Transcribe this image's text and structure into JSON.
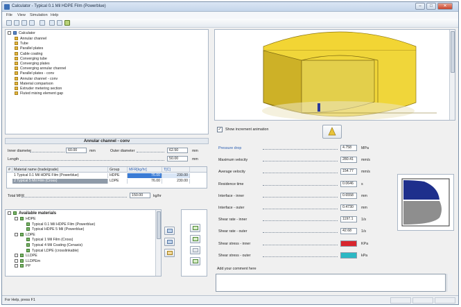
{
  "window": {
    "title": "Calculator - Typical 0.1 Mil HDPE Film (Powerblue)",
    "minimize": "–",
    "maximize": "□",
    "close": "✕"
  },
  "menu": [
    "File",
    "View",
    "Simulation",
    "Help"
  ],
  "toolbar_icons": [
    "new-icon",
    "open-icon",
    "save-icon",
    "save-as-icon",
    "print-icon",
    "export-icon",
    "report-icon",
    "calculate-icon"
  ],
  "tree": {
    "root": "Calculator",
    "items": [
      "Annular channel",
      "Tube",
      "Parallel plates",
      "Cable coating",
      "Converging tube",
      "Converging plates",
      "Converging annular channel",
      "Parallel plates - conv",
      "Annular channel - conv",
      "Material comparison",
      "Extruder metering section",
      "Fluted mixing element gap"
    ]
  },
  "form": {
    "section_title": "Annular channel - conv",
    "inner_diameter_label": "Inner diameter",
    "inner_diameter_value": "60.00",
    "inner_diameter_unit": "mm",
    "outer_diameter_label": "Outer diameter",
    "outer_diameter_value": "62.50",
    "outer_diameter_unit": "mm",
    "length_label": "Length",
    "length_value": "50.00",
    "length_unit": "mm"
  },
  "materials_table": {
    "headers": [
      "#",
      "Material name (trade/grade)",
      "Group",
      "MFR[kg/hr]",
      "T[C]"
    ],
    "rows": [
      {
        "num": "1",
        "name": "Typical 0.1 Mil HDPE Film (Powerblue)",
        "group": "HDPE",
        "mfr": "76.00",
        "temp": "230.00"
      },
      {
        "num": "2",
        "name": "Typical 5 Mil Film (Cross)",
        "group": "LDPE",
        "mfr": "76.00",
        "temp": "230.00"
      }
    ]
  },
  "total_mfr": {
    "label": "Total MFR",
    "value": "150.00",
    "unit": "kg/hr"
  },
  "available_materials": {
    "title": "Available materials",
    "groups": [
      {
        "name": "HDPE",
        "items": [
          "Typical 0.1 Mil HDPE Film (Powerblue)",
          "Typical HDPE 5 Mil (Powerblue)"
        ]
      },
      {
        "name": "LDPE",
        "items": [
          "Typical 1 Mil Film (Cross)",
          "Typical 4 Mil Coating (Cenaxis)",
          "Typical LDPE (crosslinkable)"
        ]
      },
      {
        "name": "LLDPE",
        "items": []
      },
      {
        "name": "LLDPEm",
        "items": []
      },
      {
        "name": "PP",
        "items": []
      }
    ]
  },
  "show_animation_label": "Show increment animation",
  "results": [
    {
      "label": "Pressure drop",
      "value": "4.758",
      "unit": "MPa",
      "highlight": true
    },
    {
      "label": "Maximum velocity",
      "value": "280.41",
      "unit": "mm/s"
    },
    {
      "label": "Average velocity",
      "value": "154.77",
      "unit": "mm/s"
    },
    {
      "label": "Residence time",
      "value": "0.0646",
      "unit": "s"
    },
    {
      "label": "Interface - inner",
      "value": "0.6558",
      "unit": "mm"
    },
    {
      "label": "Interface - outer",
      "value": "0.4730",
      "unit": "mm"
    },
    {
      "label": "Shear rate - inner",
      "value": "1197.1",
      "unit": "1/s"
    },
    {
      "label": "Shear rate - outer",
      "value": "42.68",
      "unit": "1/s"
    },
    {
      "label": "Shear stress - inner",
      "value": "",
      "unit": "KPa",
      "swatch": "#d8262e"
    },
    {
      "label": "Shear stress - outer",
      "value": "",
      "unit": "kPa",
      "swatch": "#2bb8c4"
    }
  ],
  "comment": {
    "label": "Add your comment here",
    "value": ""
  },
  "status": "For Help, press F1",
  "colors": {
    "ring_yellow": "#f2d534",
    "ring_dark": "#b89b1a",
    "profile_blue": "#1e2f8c",
    "profile_gray": "#8e8e8e",
    "highlight_blue": "#3a7bd5"
  }
}
